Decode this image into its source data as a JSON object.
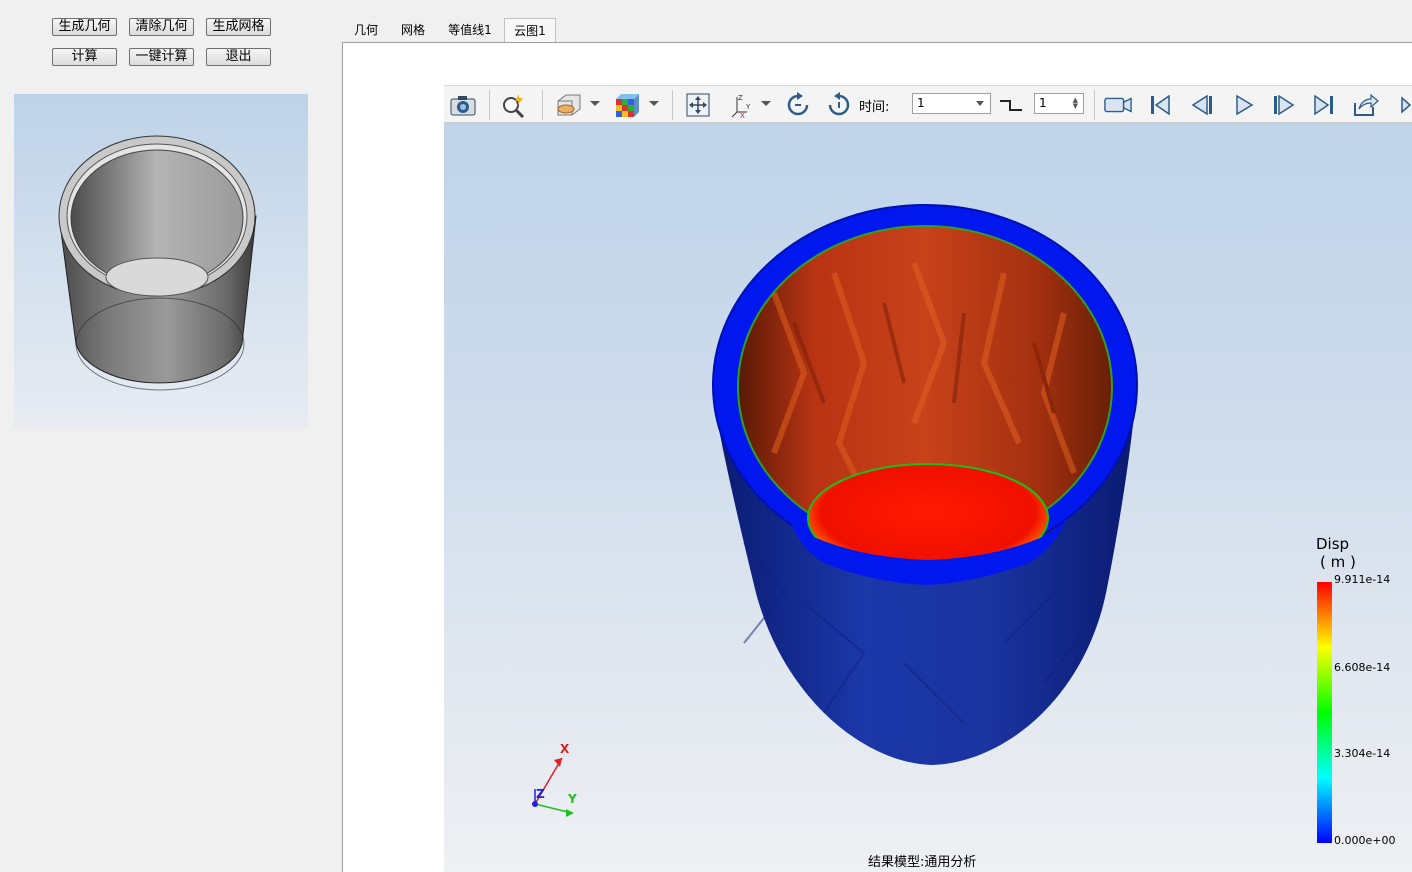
{
  "buttons": {
    "generate_geometry": "生成几何",
    "clear_geometry": "清除几何",
    "generate_mesh": "生成网格",
    "compute": "计算",
    "one_click_compute": "一键计算",
    "exit": "退出"
  },
  "tabs": [
    "几何",
    "网格",
    "等值线1",
    "云图1"
  ],
  "active_tab_index": 3,
  "toolbar": {
    "time_label": "时间:",
    "time_value": "1",
    "step_value": "1",
    "icons": [
      "camera-icon",
      "zoom-icon",
      "section-view-icon",
      "colormap-cube-icon",
      "fit-view-icon",
      "axes-orientation-icon",
      "rotate-cw-icon",
      "rotate-ccw-icon",
      "step-icon",
      "record-video-icon",
      "first-frame-icon",
      "previous-frame-icon",
      "play-icon",
      "next-frame-icon",
      "last-frame-icon",
      "export-icon"
    ]
  },
  "legend": {
    "title": "Disp",
    "unit": "( m )",
    "labels": [
      "9.911e-14",
      "6.608e-14",
      "3.304e-14",
      "0.000e+00"
    ],
    "max": 9.911e-14,
    "min": 0,
    "colors": [
      "#ff0000",
      "#ffff00",
      "#00ff00",
      "#00ffff",
      "#0000ff"
    ]
  },
  "axes": {
    "x": "X",
    "y": "Y",
    "z": "Z",
    "x_color": "#e02020",
    "y_color": "#20c020",
    "z_color": "#2020e0"
  },
  "status": {
    "model_label": "结果模型:通用分析"
  }
}
